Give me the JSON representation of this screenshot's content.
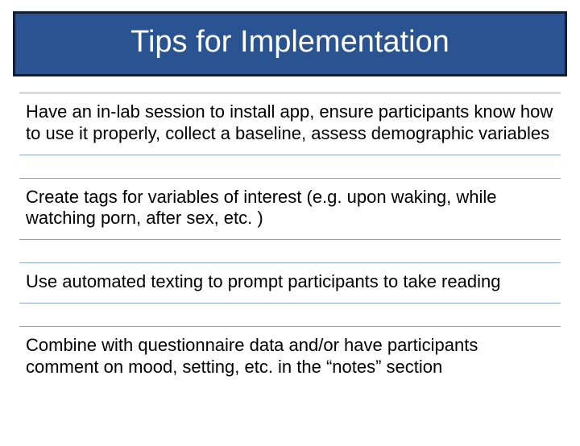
{
  "title": "Tips for Implementation",
  "tips": [
    "Have an in-lab session to install app, ensure participants know how to use it properly, collect a baseline, assess demographic variables",
    "Create tags for variables of interest (e.g. upon waking, while watching porn, after sex, etc. )",
    "Use automated texting to prompt participants to take reading",
    "Combine with questionnaire data and/or have participants comment on mood, setting, etc. in the “notes” section"
  ]
}
